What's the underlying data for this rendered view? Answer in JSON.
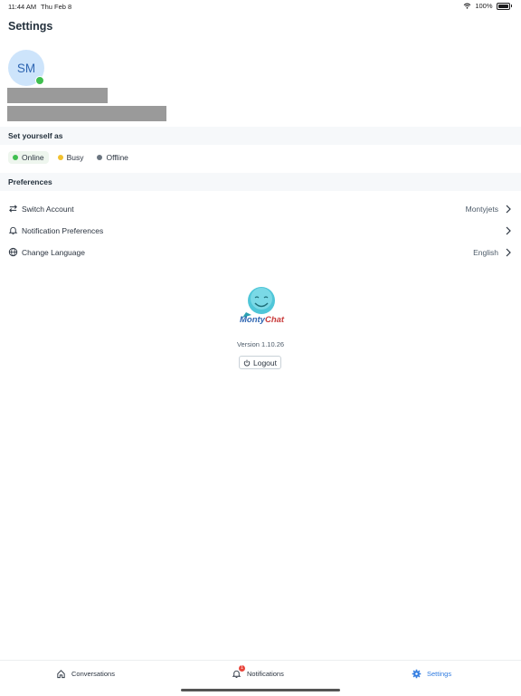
{
  "status_bar": {
    "time": "11:44 AM",
    "date": "Thu Feb 8",
    "battery": "100%"
  },
  "page": {
    "title": "Settings"
  },
  "profile": {
    "initials": "SM",
    "presence_color": "#3fbf4f"
  },
  "availability": {
    "header": "Set yourself as",
    "options": [
      {
        "label": "Online",
        "color": "#3fbf4f",
        "selected": true
      },
      {
        "label": "Busy",
        "color": "#f2c12e",
        "selected": false
      },
      {
        "label": "Offline",
        "color": "#6b7580",
        "selected": false
      }
    ]
  },
  "preferences": {
    "header": "Preferences",
    "items": [
      {
        "label": "Switch Account",
        "value": "Montyjets",
        "icon": "switch-arrows-icon"
      },
      {
        "label": "Notification Preferences",
        "value": "",
        "icon": "bell-icon"
      },
      {
        "label": "Change Language",
        "value": "English",
        "icon": "globe-icon"
      }
    ]
  },
  "app_info": {
    "logo_text_1": "Monty",
    "logo_text_2": "Chat",
    "version": "Version 1.10.26",
    "logout_label": "Logout"
  },
  "tab_bar": {
    "items": [
      {
        "label": "Conversations",
        "icon": "home-icon"
      },
      {
        "label": "Notifications",
        "icon": "bell-icon",
        "badge": "1"
      },
      {
        "label": "Settings",
        "icon": "gear-icon",
        "active": true
      }
    ]
  },
  "colors": {
    "accent": "#2f7be0",
    "avatar_bg": "#cde4fb",
    "avatar_text": "#2f66b2"
  }
}
